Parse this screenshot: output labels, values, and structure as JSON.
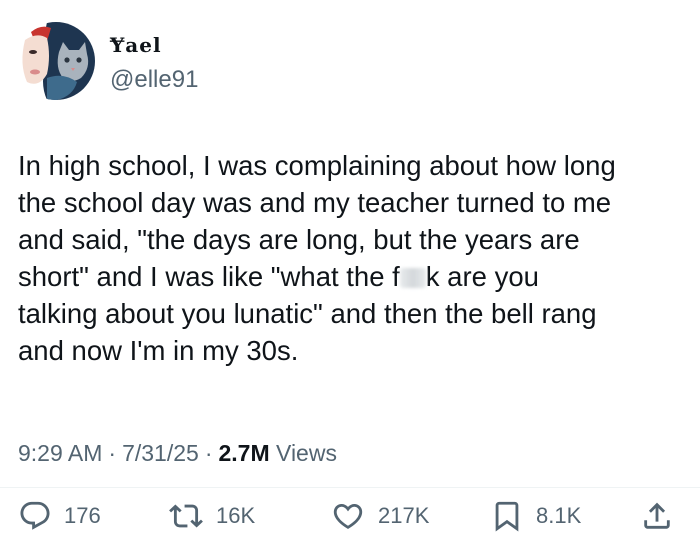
{
  "author": {
    "display_name": "Ɏael",
    "handle": "@elle91",
    "avatar_icon": "avatar-illustration-woman-with-cat"
  },
  "post": {
    "lines": [
      "In high school, I was complaining about how long",
      "the school day was and my teacher turned to me",
      "and said, \"the days are long, but the years are",
      "short\" and I was like \"what the f",
      "k are you",
      "talking about you lunatic\" and then the bell rang",
      "and now I'm in my 30s."
    ]
  },
  "meta": {
    "time": "9:29 AM",
    "separator": "·",
    "date": "7/31/25",
    "views_count": "2.7M",
    "views_label": "Views"
  },
  "actions": {
    "replies": "176",
    "reposts": "16K",
    "likes": "217K",
    "bookmarks": "8.1K"
  },
  "colors": {
    "text": "#0f1419",
    "secondary": "#536471",
    "divider": "#eff3f4"
  }
}
